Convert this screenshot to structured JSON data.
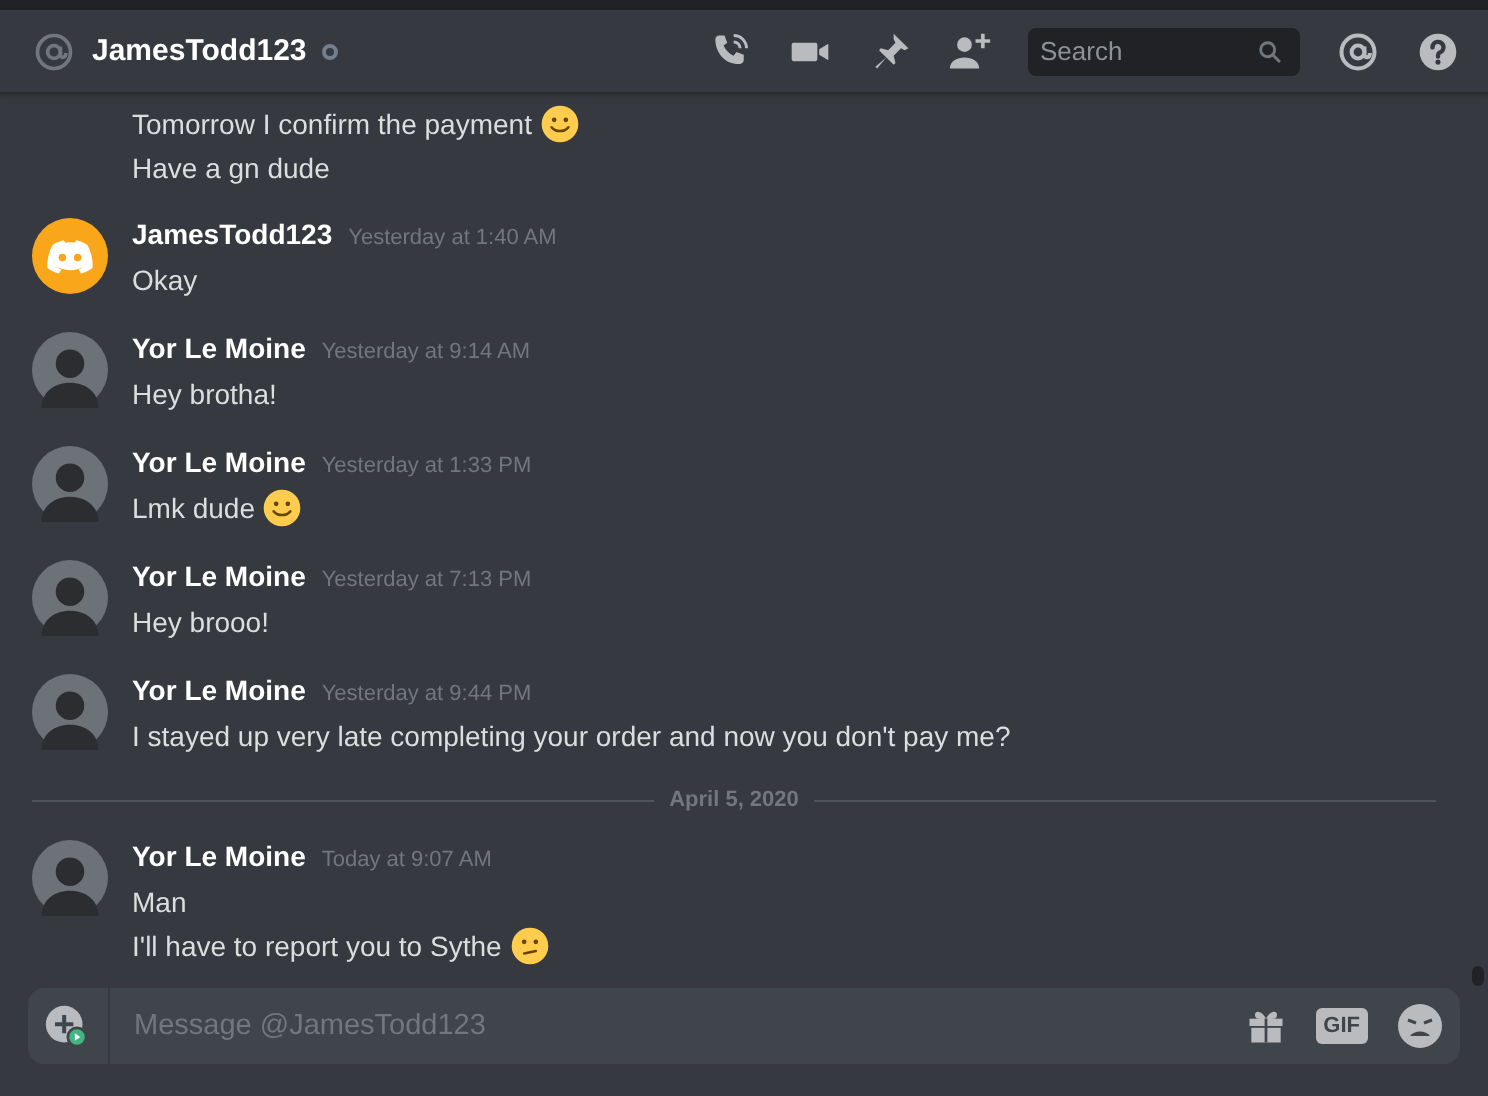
{
  "header": {
    "title": "JamesTodd123",
    "online": false,
    "search": {
      "placeholder": "Search"
    }
  },
  "timeline": [
    {
      "kind": "group",
      "lines": [
        {
          "text": "Tomorrow I confirm the payment",
          "emoji": {
            "kind": "smile"
          }
        },
        {
          "text": "Have a gn dude"
        }
      ]
    },
    {
      "kind": "group",
      "avatar": {
        "kind": "logo"
      },
      "author": "JamesTodd123",
      "time": "Yesterday at 1:40 AM",
      "lines": [
        {
          "text": "Okay"
        }
      ]
    },
    {
      "kind": "group",
      "avatar": {
        "kind": "silhouette"
      },
      "author": "Yor Le Moine",
      "time": "Yesterday at 9:14 AM",
      "lines": [
        {
          "text": "Hey brotha!"
        }
      ]
    },
    {
      "kind": "group",
      "avatar": {
        "kind": "silhouette"
      },
      "author": "Yor Le Moine",
      "time": "Yesterday at 1:33 PM",
      "lines": [
        {
          "text": "Lmk dude",
          "emoji": {
            "kind": "smile"
          }
        }
      ]
    },
    {
      "kind": "group",
      "avatar": {
        "kind": "silhouette"
      },
      "author": "Yor Le Moine",
      "time": "Yesterday at 7:13 PM",
      "lines": [
        {
          "text": "Hey brooo!"
        }
      ]
    },
    {
      "kind": "group",
      "avatar": {
        "kind": "silhouette"
      },
      "author": "Yor Le Moine",
      "time": "Yesterday at 9:44 PM",
      "lines": [
        {
          "text": "I stayed up very late completing your order and now you don't pay me?"
        }
      ]
    },
    {
      "kind": "divider",
      "label": "April 5, 2020"
    },
    {
      "kind": "group",
      "avatar": {
        "kind": "silhouette"
      },
      "author": "Yor Le Moine",
      "time": "Today at 9:07 AM",
      "lines": [
        {
          "text": "Man"
        },
        {
          "text": "I'll have to report you to Sythe",
          "emoji": {
            "kind": "neutral"
          }
        }
      ]
    }
  ],
  "composer": {
    "placeholder": "Message @JamesTodd123",
    "gif_label": "GIF"
  }
}
